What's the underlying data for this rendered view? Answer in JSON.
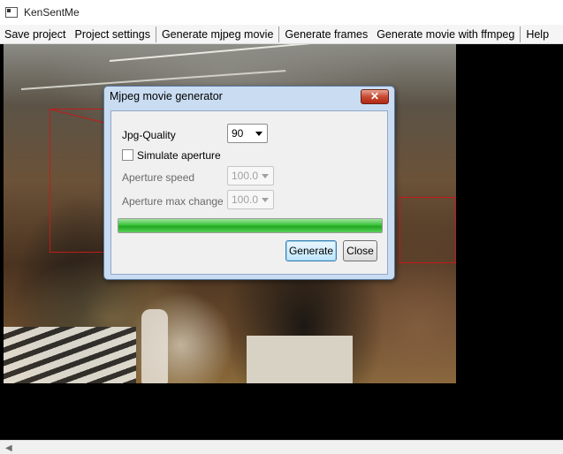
{
  "window": {
    "title": "KenSentMe"
  },
  "menu": {
    "save_project": "Save project",
    "project_settings": "Project settings",
    "generate_mjpeg": "Generate mjpeg movie",
    "generate_frames": "Generate frames",
    "generate_ffmpeg": "Generate movie with ffmpeg",
    "help": "Help"
  },
  "dialog": {
    "title": "Mjpeg movie generator",
    "close_glyph": "✕",
    "jpg_quality_label": "Jpg-Quality",
    "jpg_quality_value": "90",
    "simulate_aperture_label": "Simulate aperture",
    "simulate_aperture_checked": false,
    "aperture_speed_label": "Aperture speed",
    "aperture_speed_value": "100.0",
    "aperture_max_change_label": "Aperture max change",
    "aperture_max_change_value": "100.0",
    "progress_fraction": 1.0,
    "generate_label": "Generate",
    "close_label": "Close"
  },
  "icons": {
    "app": "app-window-icon",
    "scroll_left": "scroll-left-arrow-icon"
  },
  "colors": {
    "selection_box": "#c21b1b",
    "progress_fill": "#3cc23c"
  }
}
